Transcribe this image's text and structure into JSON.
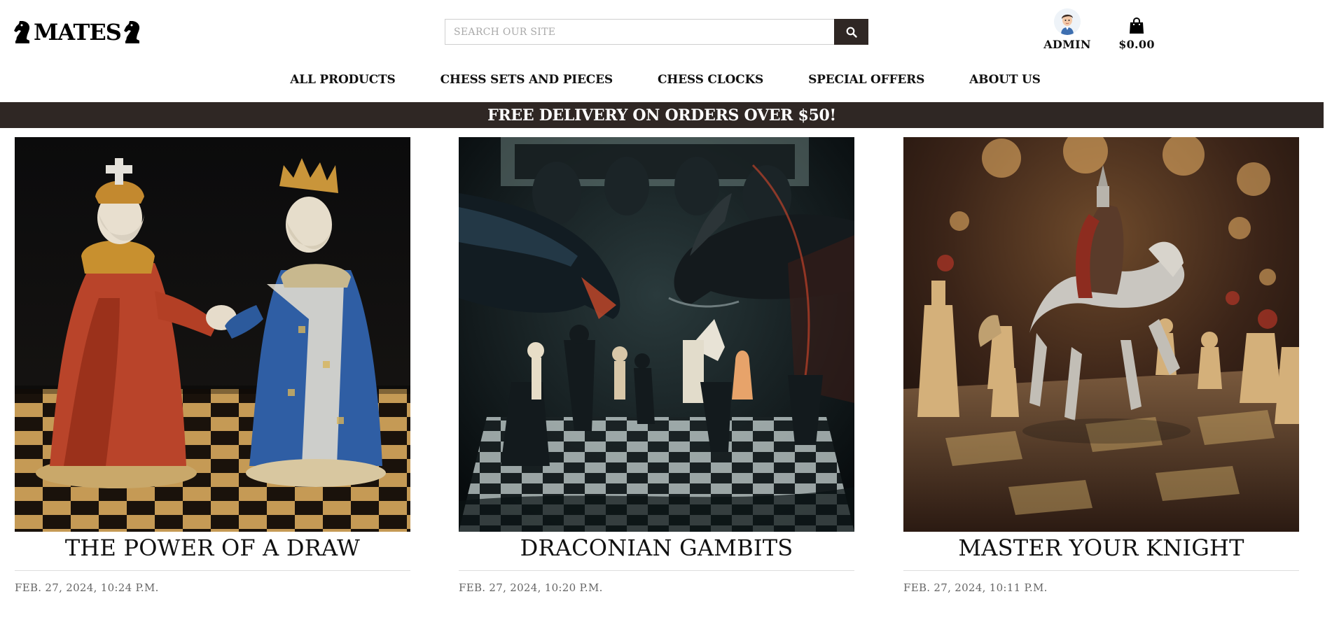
{
  "brand": {
    "name": "MATES"
  },
  "search": {
    "placeholder": "SEARCH OUR SITE",
    "icon": "search-icon"
  },
  "account": {
    "label": "ADMIN",
    "icon": "avatar"
  },
  "cart": {
    "total": "$0.00",
    "icon": "shopping-bag-icon"
  },
  "nav": {
    "items": [
      {
        "label": "ALL PRODUCTS"
      },
      {
        "label": "CHESS SETS AND PIECES"
      },
      {
        "label": "CHESS CLOCKS"
      },
      {
        "label": "SPECIAL OFFERS"
      },
      {
        "label": "ABOUT US"
      }
    ]
  },
  "banner": {
    "text": "FREE DELIVERY ON ORDERS OVER $50!"
  },
  "posts": [
    {
      "title": "THE POWER OF A DRAW",
      "date": "FEB. 27, 2024, 10:24 P.M."
    },
    {
      "title": "DRACONIAN GAMBITS",
      "date": "FEB. 27, 2024, 10:20 P.M."
    },
    {
      "title": "MASTER YOUR KNIGHT",
      "date": "FEB. 27, 2024, 10:11 P.M."
    }
  ],
  "colors": {
    "accent": "#2f2724",
    "text": "#111111",
    "muted": "#666666"
  }
}
